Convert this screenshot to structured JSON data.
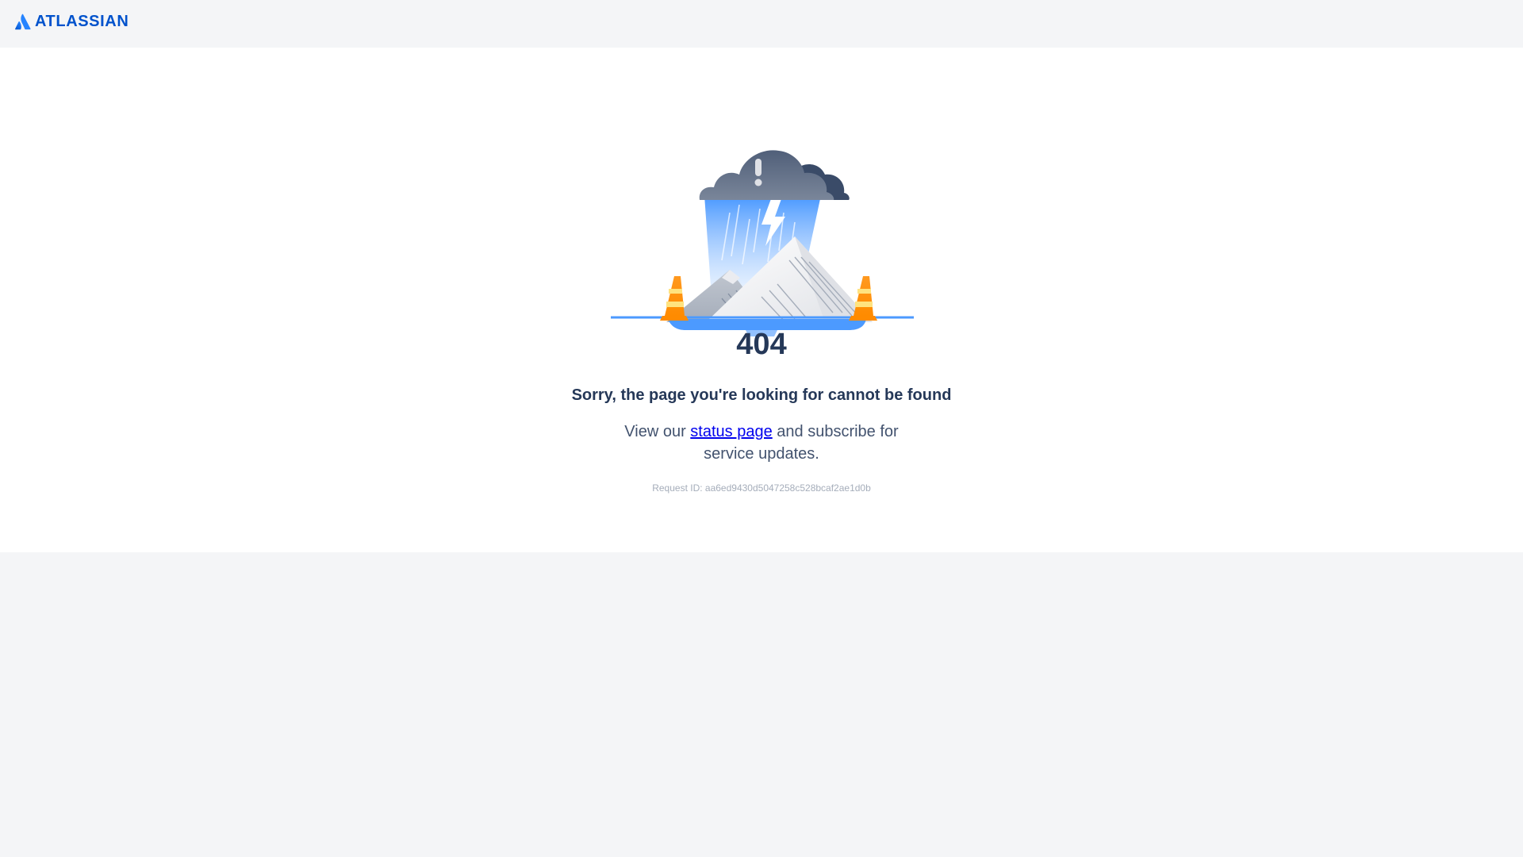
{
  "header": {
    "brand": "ATLASSIAN",
    "brand_color": "#0052cc",
    "logo_icon": "atlassian-logo-icon"
  },
  "error": {
    "illustration_icon": "storm-cloud-mountains-traffic-cones-icon",
    "code": "404",
    "title": "Sorry, the page you're looking for cannot be found",
    "status_prefix": "View our ",
    "status_link": "status page",
    "status_suffix": " and subscribe for service updates.",
    "request_id": "Request ID: aa6ed9430d5047258c528bcaf2ae1d0b"
  },
  "colors": {
    "text_primary": "#253858",
    "text_secondary": "#42526e",
    "muted": "#a5adba",
    "page_bg": "#f4f5f7",
    "card_bg": "#ffffff",
    "link": "#0000ee"
  }
}
